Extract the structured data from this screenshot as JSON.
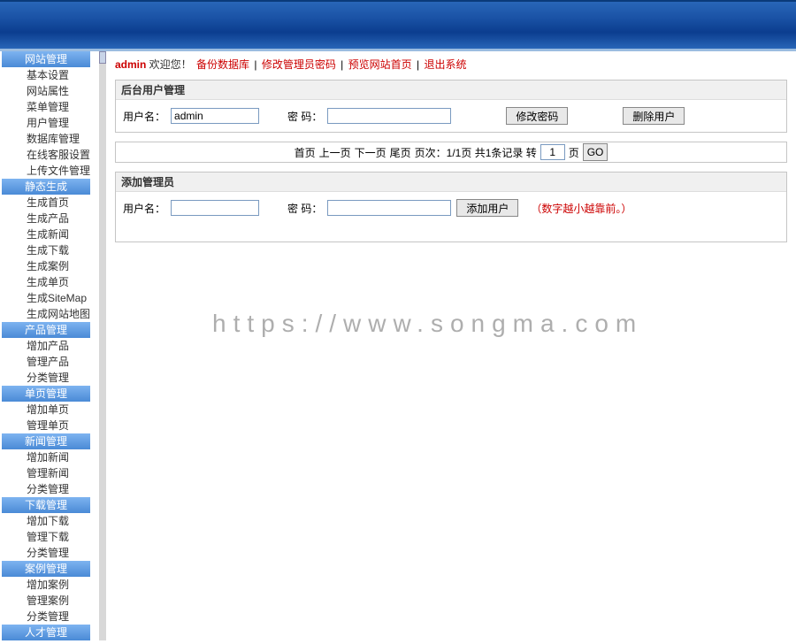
{
  "header": {},
  "sidebar": {
    "groups": [
      {
        "header": "网站管理",
        "items": [
          "基本设置",
          "网站属性",
          "菜单管理",
          "用户管理",
          "数据库管理",
          "在线客服设置",
          "上传文件管理"
        ]
      },
      {
        "header": "静态生成",
        "items": [
          "生成首页",
          "生成产品",
          "生成新闻",
          "生成下载",
          "生成案例",
          "生成单页",
          "生成SiteMap",
          "生成网站地图"
        ]
      },
      {
        "header": "产品管理",
        "items": [
          "增加产品",
          "管理产品",
          "分类管理"
        ]
      },
      {
        "header": "单页管理",
        "items": [
          "增加单页",
          "管理单页"
        ]
      },
      {
        "header": "新闻管理",
        "items": [
          "增加新闻",
          "管理新闻",
          "分类管理"
        ]
      },
      {
        "header": "下载管理",
        "items": [
          "增加下载",
          "管理下载",
          "分类管理"
        ]
      },
      {
        "header": "案例管理",
        "items": [
          "增加案例",
          "管理案例",
          "分类管理"
        ]
      },
      {
        "header": "人才管理",
        "items": []
      }
    ]
  },
  "topline": {
    "admin": "admin",
    "welcome": " 欢迎您！ ",
    "links": [
      "备份数据库",
      "修改管理员密码",
      "预览网站首页",
      "退出系统"
    ],
    "sep": " | "
  },
  "panel1": {
    "title": "后台用户管理",
    "username_label": "用户名：",
    "username_value": "admin",
    "password_label": "密  码：",
    "btn_change": "修改密码",
    "btn_delete": "删除用户"
  },
  "pagination": {
    "first": "首页",
    "prev": "上一页",
    "next": "下一页",
    "last": "尾页",
    "info": "页次：1/1页  共1条记录  转",
    "page_value": "1",
    "page_suffix": "页",
    "go": "GO"
  },
  "panel2": {
    "title": "添加管理员",
    "username_label": "用户名：",
    "password_label": "密  码：",
    "btn_add": "添加用户",
    "note": "（数字越小越靠前。）"
  },
  "watermark": "https://www.songma.com"
}
